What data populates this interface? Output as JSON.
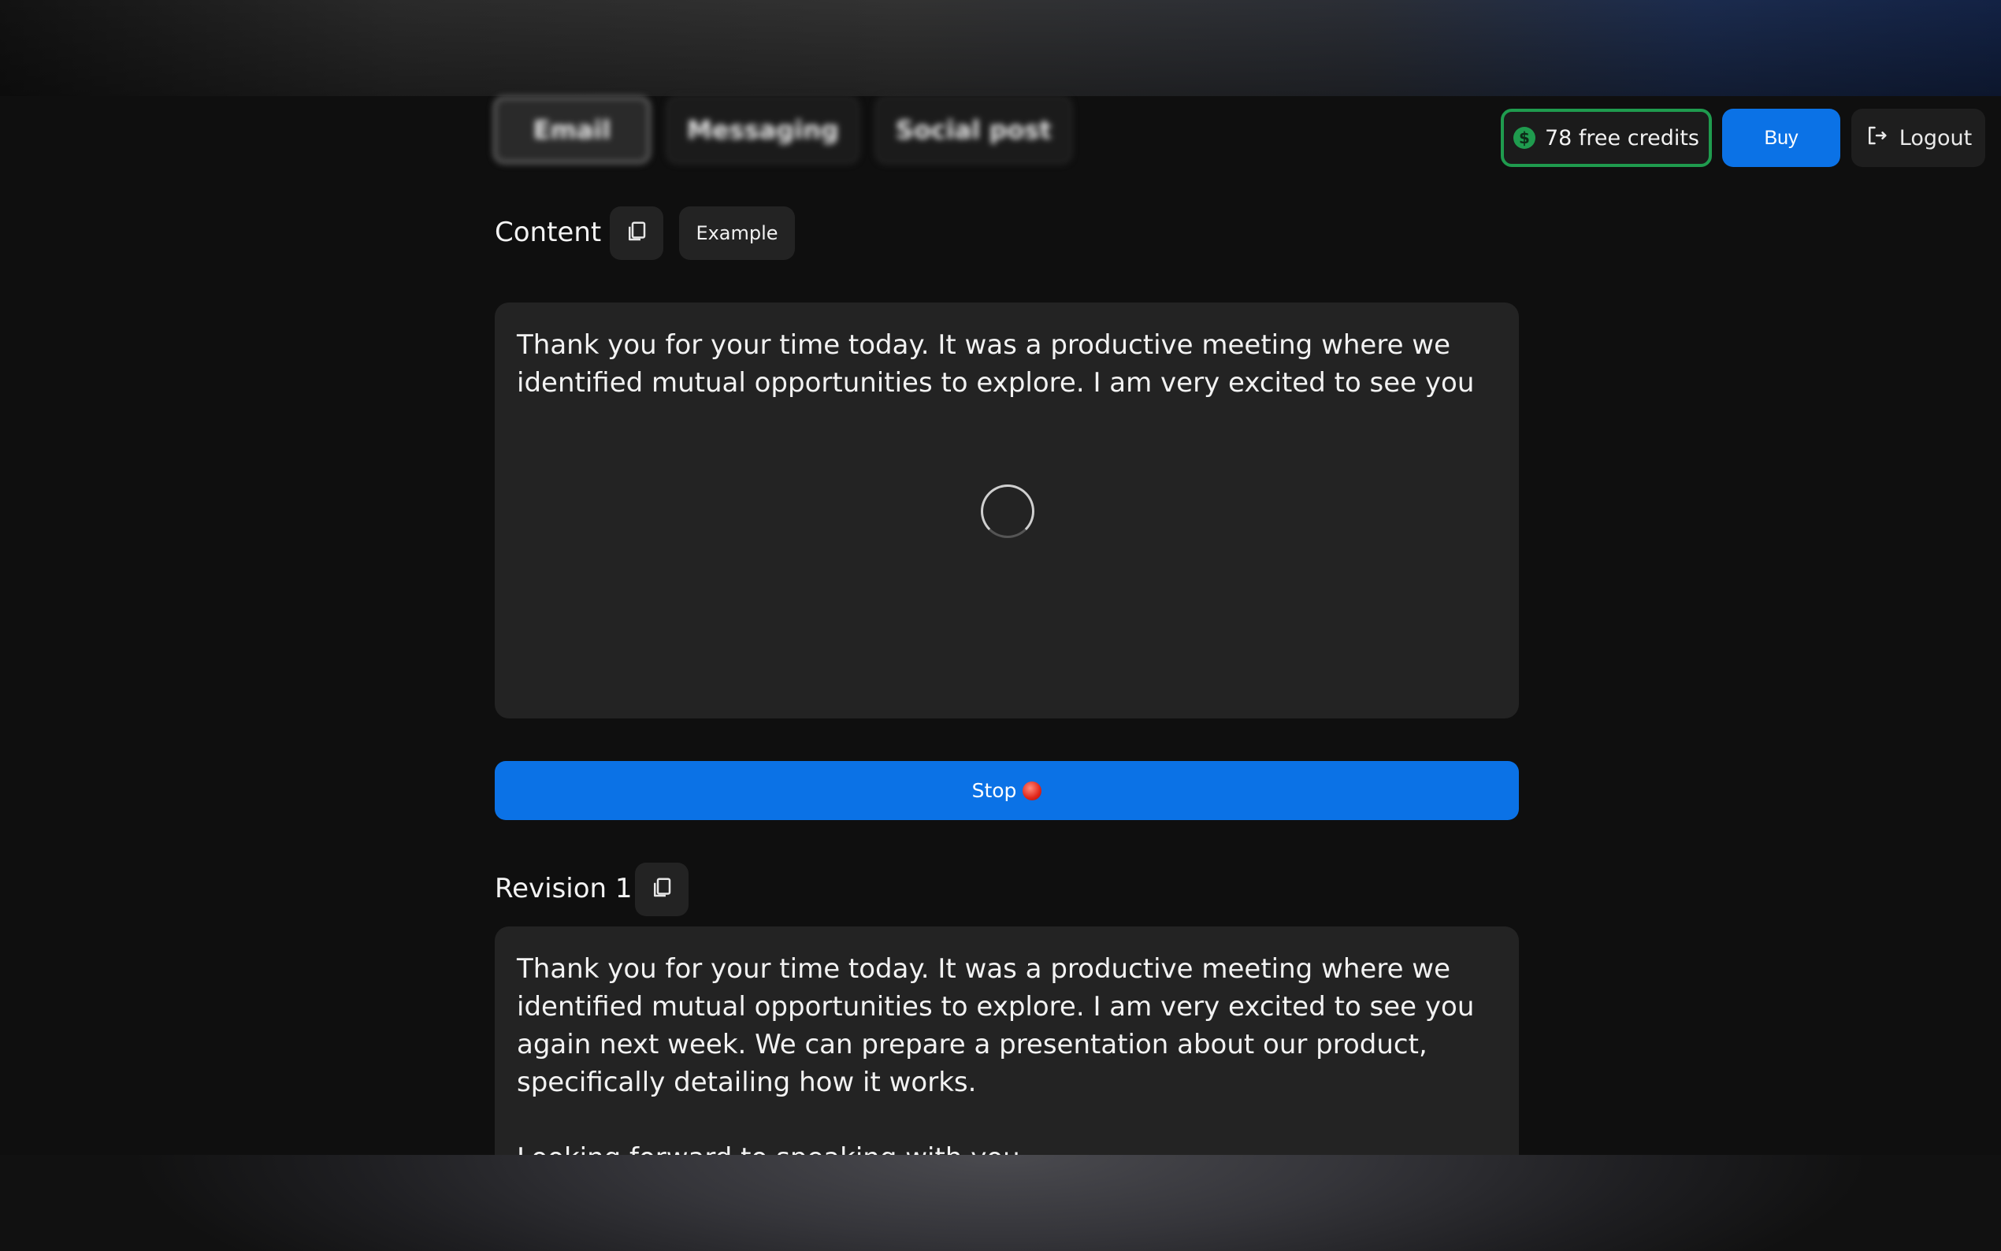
{
  "header": {
    "tabs": [
      {
        "label": "Email",
        "active": true
      },
      {
        "label": "Messaging",
        "active": false
      },
      {
        "label": "Social post",
        "active": false
      }
    ],
    "credits_label": "78 free credits",
    "credits_icon": "dollar-circle-icon",
    "buy_label": "Buy",
    "logout_label": "Logout",
    "logout_icon": "logout-icon"
  },
  "content": {
    "title": "Content",
    "copy_icon": "copy-icon",
    "example_label": "Example",
    "text": "Thank you for your time today. It was a productive meeting where we identified mutual opportunities to explore. I am very excited to see you",
    "loading": true
  },
  "stop_button": {
    "label": "Stop",
    "icon": "red-circle-icon"
  },
  "revision": {
    "title": "Revision 1",
    "copy_icon": "copy-icon",
    "text": "Thank you for your time today. It was a productive meeting where we identified mutual opportunities to explore. I am very excited to see you again next week. We can prepare a presentation about our product, specifically detailing how it works.\n\nLooking forward to speaking with you."
  },
  "colors": {
    "background": "#0f0f0f",
    "panel": "#232323",
    "accent_blue": "#0b72e6",
    "credits_green": "#1f9b4e"
  }
}
